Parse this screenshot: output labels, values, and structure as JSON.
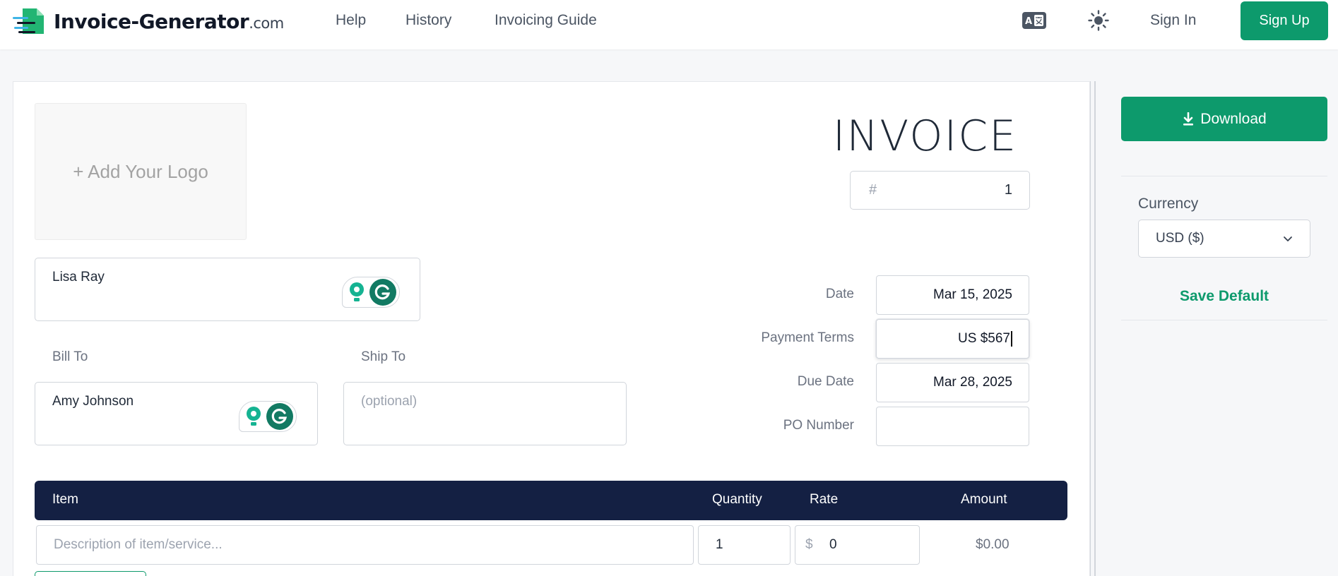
{
  "header": {
    "brand_name": "Invoice-Generator",
    "brand_domain": ".com",
    "nav": [
      "Help",
      "History",
      "Invoicing Guide"
    ],
    "translate_icon": "translate-icon",
    "theme_icon": "sun-icon",
    "sign_in": "Sign In",
    "sign_up": "Sign Up",
    "accent_color": "#0d9a6c"
  },
  "invoice": {
    "add_logo": "+ Add Your Logo",
    "title": "INVOICE",
    "number_prefix": "#",
    "number": "1",
    "from_value": "Lisa Ray",
    "bill_to_label": "Bill To",
    "bill_to_value": "Amy Johnson",
    "ship_to_label": "Ship To",
    "ship_to_placeholder": "(optional)",
    "date_label": "Date",
    "date_value": "Mar 15, 2025",
    "payment_terms_label": "Payment Terms",
    "payment_terms_value": "US $567",
    "due_date_label": "Due Date",
    "due_date_value": "Mar 28, 2025",
    "po_number_label": "PO Number",
    "po_number_value": ""
  },
  "line_items": {
    "headers": {
      "item": "Item",
      "quantity": "Quantity",
      "rate": "Rate",
      "amount": "Amount"
    },
    "header_color": "#142043",
    "rows": [
      {
        "description_placeholder": "Description of item/service...",
        "quantity": "1",
        "currency_symbol": "$",
        "rate": "0",
        "amount": "$0.00"
      }
    ]
  },
  "sidebar": {
    "download_label": "Download",
    "download_icon": "download-icon",
    "currency_label": "Currency",
    "currency_value": "USD ($)",
    "save_default": "Save Default"
  }
}
